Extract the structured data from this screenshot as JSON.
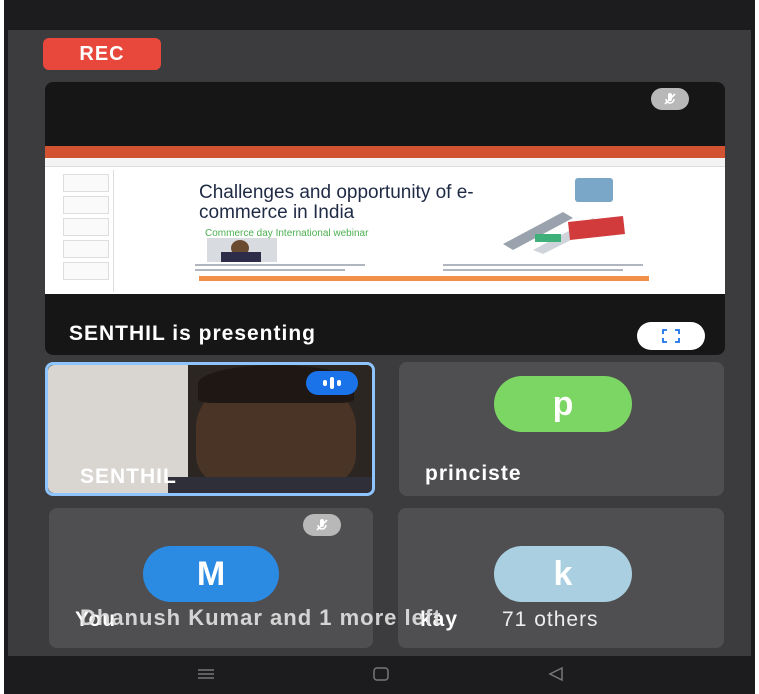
{
  "recording": {
    "label": "REC"
  },
  "presentation": {
    "presenter_label": "SENTHIL is presenting",
    "slide": {
      "title": "Challenges and opportunity of e-commerce in India",
      "subtitle": "Commerce day International webinar"
    }
  },
  "participants": [
    {
      "name": "SENTHIL",
      "talking": true
    },
    {
      "name": "princiste",
      "avatar_letter": "p",
      "avatar_color": "#7cd663"
    },
    {
      "name": "You",
      "avatar_letter": "M",
      "avatar_color": "#2b8be3",
      "muted": true
    },
    {
      "name": "kay",
      "avatar_letter": "k",
      "avatar_color": "#a9cfe0"
    }
  ],
  "others_badge": "71 others",
  "notification": "Dhanush Kumar and 1 more left",
  "colors": {
    "rec": "#e8483b",
    "talking_border": "#8ec5ff",
    "background": "#3c3c3e"
  },
  "icons": {
    "mute": "mic-off-icon",
    "fullscreen": "fullscreen-icon",
    "talking": "audio-level-icon"
  }
}
